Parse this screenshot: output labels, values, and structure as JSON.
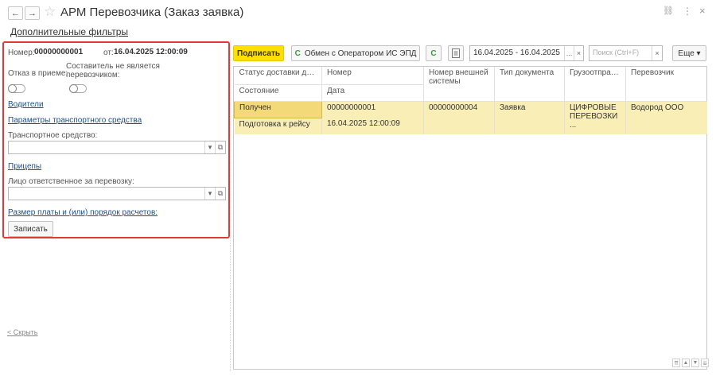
{
  "window": {
    "title": "АРМ Перевозчика (Заказ заявка)",
    "back_icon": "←",
    "forward_icon": "→",
    "star_icon": "☆",
    "link_icon": "⛓",
    "menu_icon": "⋮",
    "close_icon": "×"
  },
  "filters_link": "Дополнительные фильтры",
  "left": {
    "number_label": "Номер:",
    "number_value": "00000000001",
    "date_label": "от:",
    "date_value": "16.04.2025 12:00:09",
    "reject_label": "Отказ в приеме:",
    "composer_label": "Составитель не является перевозчиком:",
    "drivers_link": "Водители",
    "vehicle_params_link": "Параметры транспортного средства",
    "vehicle_label": "Транспортное средство:",
    "vehicle_value": "",
    "trailers_link": "Прицепы",
    "responsible_label": "Лицо ответственное за перевозку:",
    "responsible_value": "",
    "payment_link": "Размер платы и (или) порядок расчетов:",
    "save_button": "Записать",
    "hide_link": "< Скрыть",
    "dropdown_glyph": "▾",
    "open_glyph": "⧉"
  },
  "toolbar": {
    "sign_button": "Подписать",
    "exchange_button": "Обмен с Оператором ИС ЭПД",
    "refresh_glyph": "C",
    "period_value": "16.04.2025 - 16.04.2025",
    "period_more": "...",
    "clear_glyph": "×",
    "search_placeholder": "Поиск (Ctrl+F)",
    "more_button": "Еще ▾"
  },
  "table": {
    "columns_top": [
      "Статус доставки до ...",
      "Номер",
      "Номер внешней системы",
      "Тип документа",
      "Грузоотправитель",
      "Перевозчик"
    ],
    "columns_bottom": [
      "Состояние",
      "Дата"
    ],
    "rows": [
      {
        "status": "Получен",
        "number": "00000000001",
        "external_number": "00000000004",
        "doc_type": "Заявка",
        "shipper": "ЦИФРОВЫЕ ПЕРЕВОЗКИ ...",
        "carrier": "Водород ООО",
        "state": "Подготовка к рейсу",
        "date": "16.04.2025 12:00:09"
      }
    ]
  },
  "scroll": {
    "first_glyph": "⇈",
    "up_glyph": "▲",
    "down_glyph": "▼",
    "last_glyph": "⇊"
  },
  "colors": {
    "highlight_border": "#e53935",
    "selected_row": "#f9eeb5",
    "sign_button": "#ffe000",
    "link": "#1d4f91"
  }
}
